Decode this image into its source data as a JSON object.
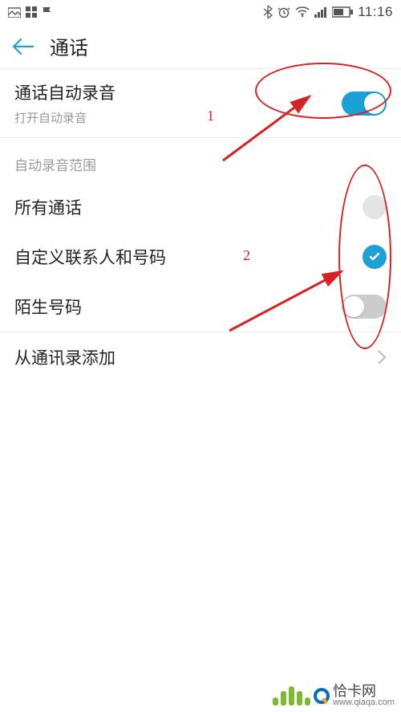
{
  "status": {
    "time": "11:16"
  },
  "header": {
    "title": "通话"
  },
  "auto_record": {
    "title": "通话自动录音",
    "subtitle": "打开自动录音",
    "enabled": true
  },
  "scope_section_title": "自动录音范围",
  "options": {
    "all_calls": {
      "label": "所有通话",
      "checked": false
    },
    "custom_contacts": {
      "label": "自定义联系人和号码",
      "checked": true
    },
    "unknown_numbers": {
      "label": "陌生号码",
      "enabled": false
    }
  },
  "add_from_contacts_label": "从通讯录添加",
  "annotations": {
    "num1": "1",
    "num2": "2"
  },
  "watermark": {
    "name": "恰卡网",
    "url": "www.qiaqa.com"
  }
}
